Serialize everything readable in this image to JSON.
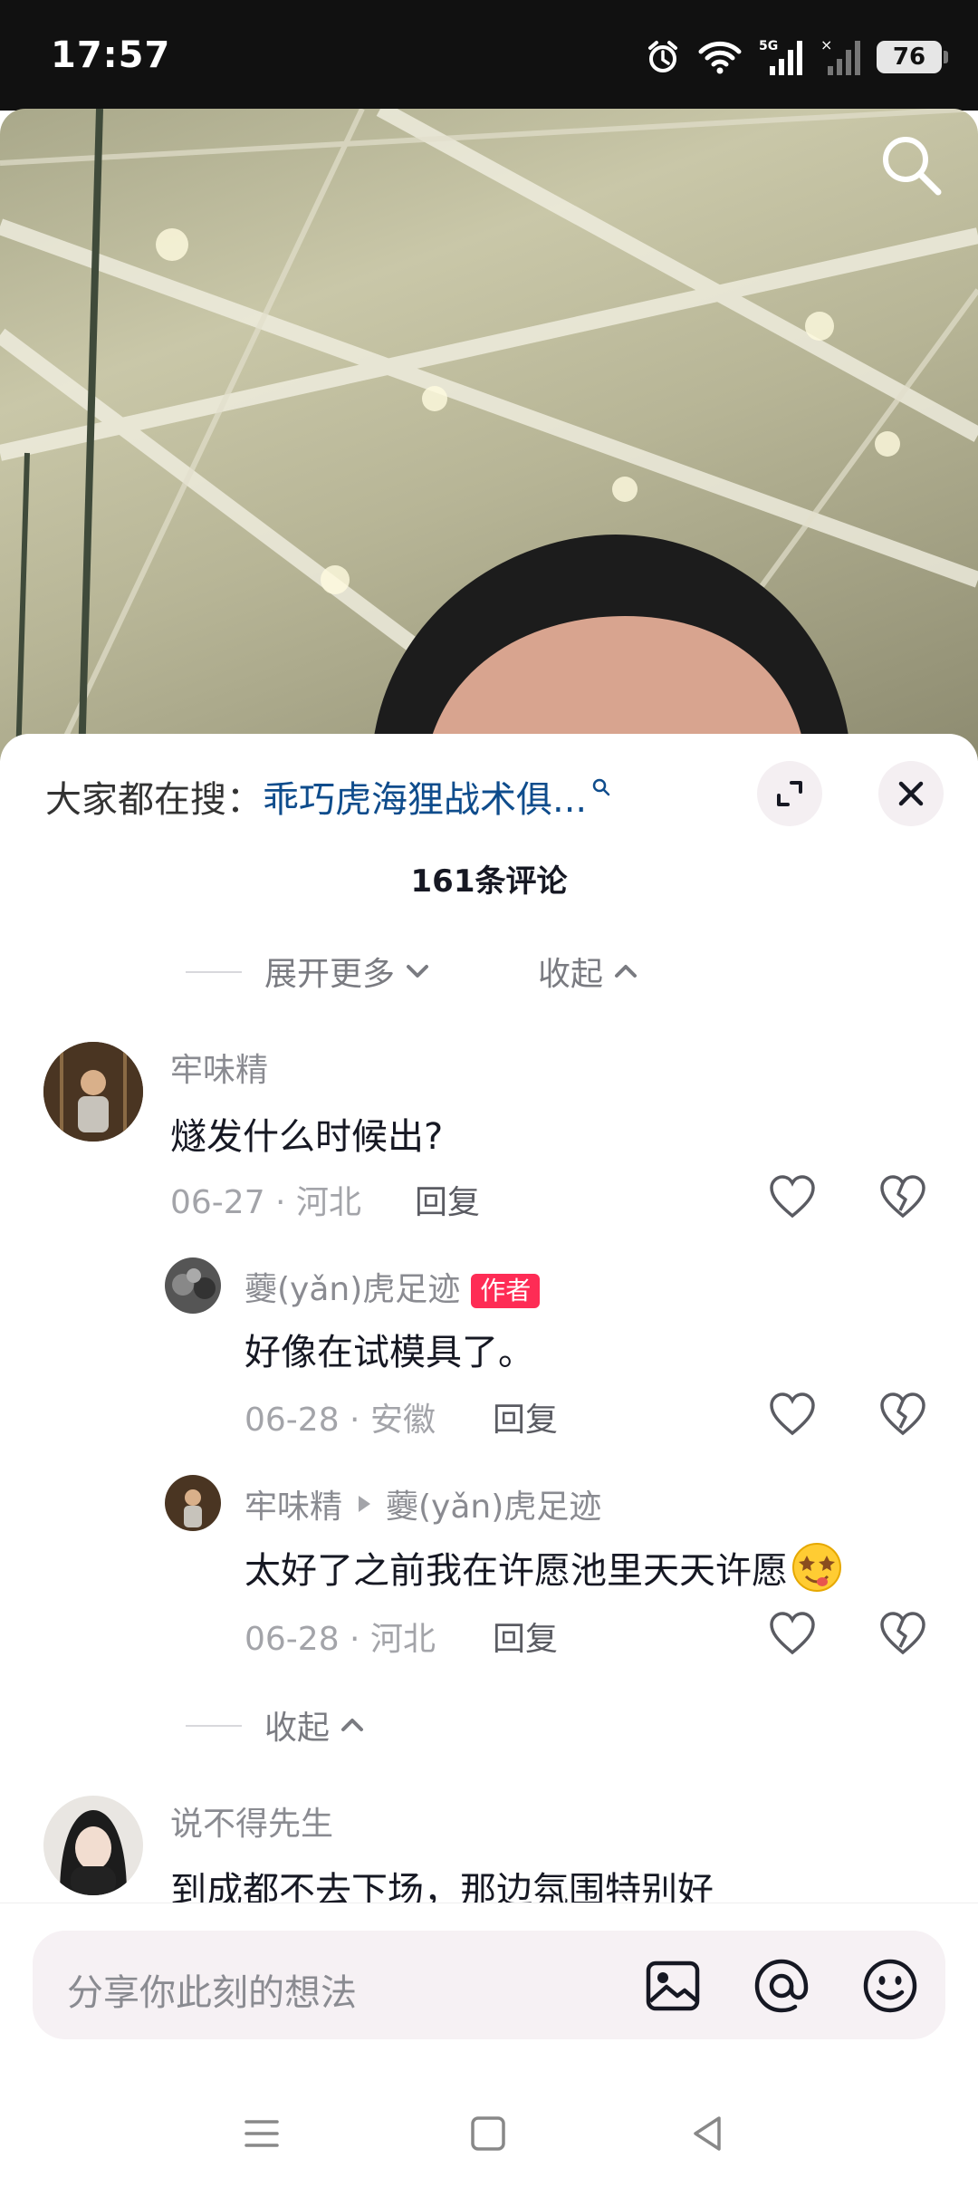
{
  "status_bar": {
    "time": "17:57",
    "network": "5G",
    "battery": "76"
  },
  "video": {
    "search_label": "search"
  },
  "header": {
    "hot_search_prefix": "大家都在搜：",
    "hot_search_link": "乖巧虎海狸战术俱...",
    "comment_count": "161条评论"
  },
  "thread_controls": {
    "expand_more": "展开更多",
    "collapse": "收起"
  },
  "comments": [
    {
      "user": "牢味精",
      "text": "燧发什么时候出?",
      "date": "06-27 · 河北",
      "reply_label": "回复",
      "replies": [
        {
          "user": "虁(yǎn)虎足迹",
          "badge": "作者",
          "text": "好像在试模具了。",
          "date": "06-28 · 安徽",
          "reply_label": "回复"
        },
        {
          "user": "牢味精",
          "reply_to": "虁(yǎn)虎足迹",
          "text": "太好了之前我在许愿池里天天许愿",
          "date": "06-28 · 河北",
          "reply_label": "回复"
        }
      ],
      "collapse_label": "收起"
    },
    {
      "user": "说不得先生",
      "text": "到成都不去下场，那边氛围特别好"
    }
  ],
  "input": {
    "placeholder": "分享你此刻的想法"
  },
  "colors": {
    "link": "#0e4c8c",
    "author_badge": "#fe2c55",
    "input_bg": "#f6f1f4"
  }
}
